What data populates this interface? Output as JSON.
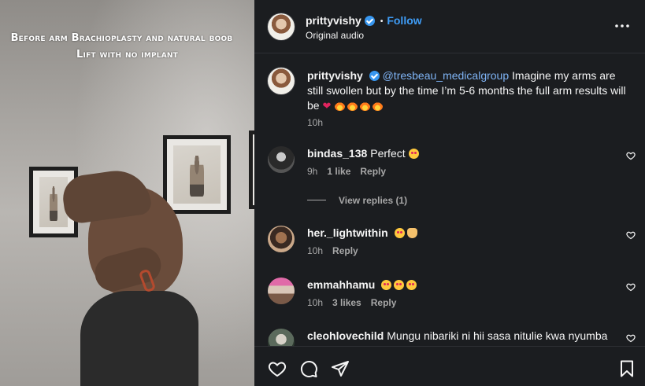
{
  "media": {
    "caption_line1": "Before arm Brachioplasty and natural boob",
    "caption_line2": "Lift with no implant"
  },
  "header": {
    "username": "prittyvishy",
    "verified": true,
    "separator": "•",
    "follow_label": "Follow",
    "audio": "Original audio",
    "more_icon": "more-options-icon"
  },
  "post_caption": {
    "username": "prittyvishy",
    "mention": "@tresbeau_medicalgroup",
    "text": " Imagine my arms are still swollen but by the time I’m 5-6 months the full arm results will be",
    "emojis": [
      "red-heart",
      "fire",
      "fire",
      "fire",
      "fire"
    ],
    "time": "10h"
  },
  "comments": [
    {
      "username": "bindas_138",
      "text": "Perfect",
      "emojis": [
        "star-struck"
      ],
      "time": "9h",
      "likes": "1 like",
      "reply_label": "Reply",
      "view_replies": "View replies (1)"
    },
    {
      "username": "her._lightwithin",
      "text": "",
      "emojis": [
        "star-struck",
        "waving-hand"
      ],
      "time": "10h",
      "likes": "",
      "reply_label": "Reply"
    },
    {
      "username": "emmahhamu",
      "text": "",
      "emojis": [
        "star-struck",
        "star-struck",
        "star-struck"
      ],
      "time": "10h",
      "likes": "3 likes",
      "reply_label": "Reply"
    },
    {
      "username": "cleohlovechild",
      "text": "Mungu nibariki ni hii sasa nitulie kwa nyumba",
      "emojis": [],
      "time": "",
      "likes": "",
      "reply_label": ""
    }
  ],
  "actions": {
    "like_icon": "heart-icon",
    "comment_icon": "comment-icon",
    "share_icon": "share-icon",
    "save_icon": "bookmark-icon"
  },
  "colors": {
    "panel_bg": "#1b1d20",
    "accent_blue": "#3f9df7",
    "mention_blue": "#7fb4f5",
    "muted_text": "#a8a8a8"
  }
}
